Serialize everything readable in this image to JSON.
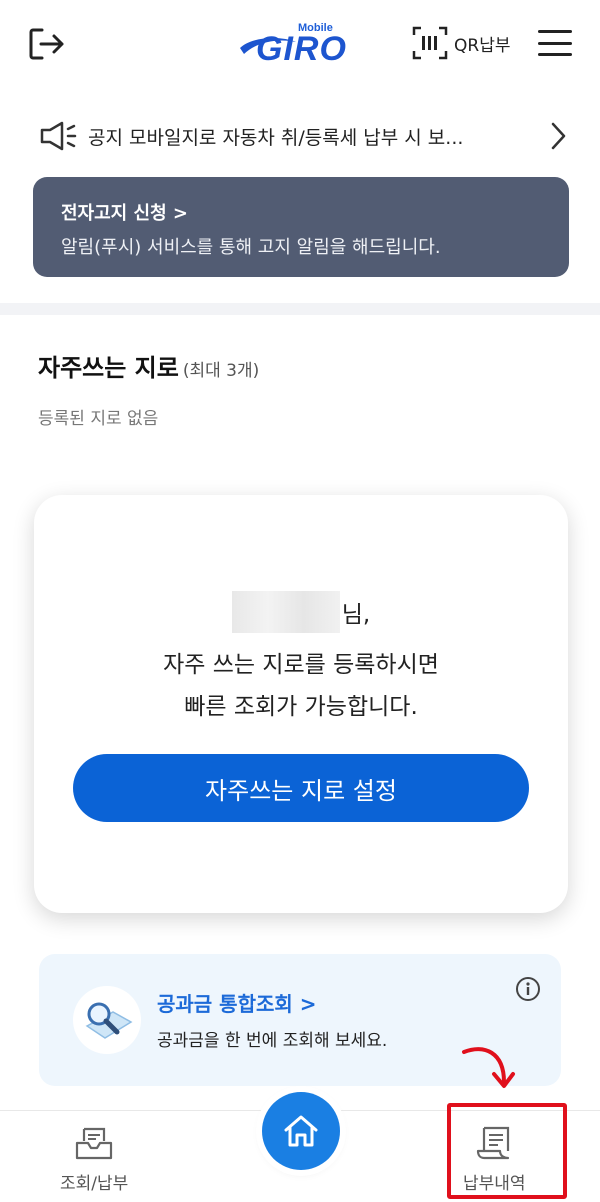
{
  "header": {
    "logo_small": "Mobile",
    "logo_main": "GIRO",
    "qr_label": "QR납부",
    "icons": [
      "logout-icon",
      "qr-icon",
      "hamburger-icon"
    ]
  },
  "notice": {
    "text": "공지  모바일지로 자동차 취/등록세 납부 시 보..."
  },
  "ebill": {
    "title": "전자고지 신청 >",
    "desc": "알림(푸시) 서비스를 통해 고지 알림을 해드립니다.",
    "color": "#525c73"
  },
  "favorites": {
    "title": "자주쓰는 지로",
    "subtitle": "(최대 3개)",
    "empty": "등록된 지로 없음"
  },
  "card": {
    "name_suffix": "님,",
    "line1": "자주 쓰는 지로를 등록하시면",
    "line2": "빠른 조회가 가능합니다.",
    "button": "자주쓰는 지로 설정",
    "button_color": "#0b63d6"
  },
  "utility": {
    "title": "공과금 통합조회 >",
    "desc": "공과금을 한 번에 조회해 보세요."
  },
  "tabbar": {
    "left_label": "조회/납부",
    "right_label": "납부내역",
    "home_color": "#1a7fe3",
    "highlight_color": "#e0101c"
  }
}
